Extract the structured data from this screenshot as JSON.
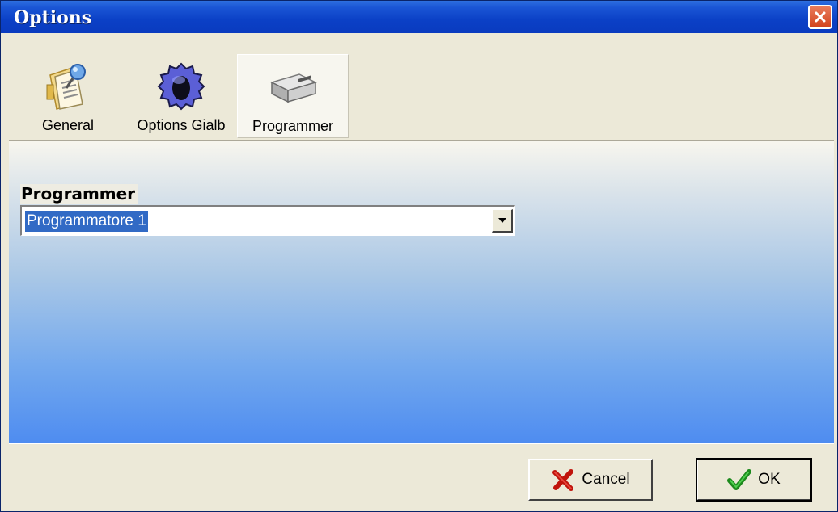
{
  "window": {
    "title": "Options",
    "close_icon": "close-icon"
  },
  "tabs": [
    {
      "label": "General",
      "icon": "document-pushpin-icon",
      "selected": false
    },
    {
      "label": "Options Gialb",
      "icon": "gear-icon",
      "selected": false
    },
    {
      "label": "Programmer",
      "icon": "programmer-device-icon",
      "selected": true
    }
  ],
  "panel": {
    "field_label": "Programmer",
    "select_value": "Programmatore 1",
    "dropdown_icon": "chevron-down-icon"
  },
  "buttons": {
    "cancel_label": "Cancel",
    "cancel_icon": "red-x-icon",
    "ok_label": "OK",
    "ok_icon": "green-check-icon"
  },
  "colors": {
    "titlebar": "#0a3bbf",
    "selection": "#316ac5",
    "dialog_face": "#ece9d8"
  }
}
